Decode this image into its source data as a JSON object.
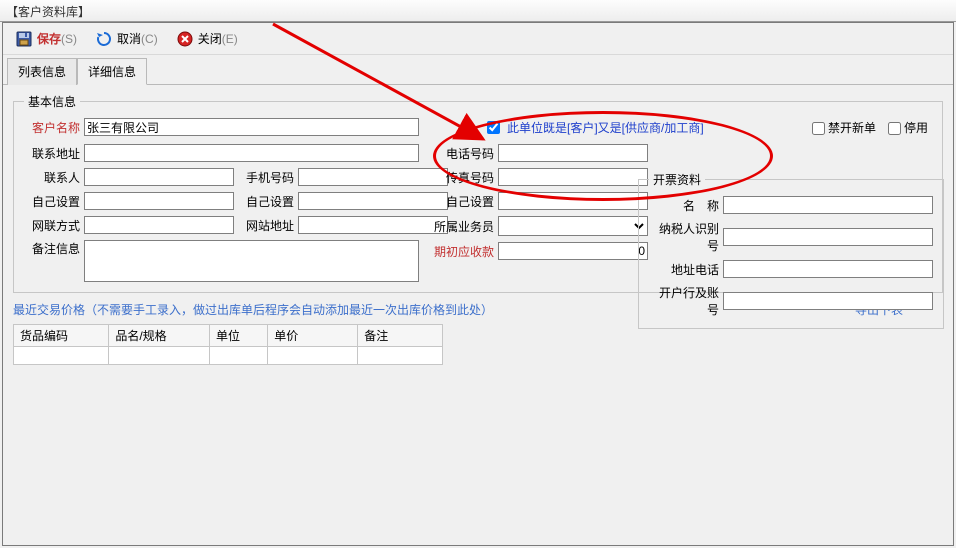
{
  "window": {
    "title": "【客户资料库】"
  },
  "toolbar": {
    "save": "保存",
    "save_hot": "(S)",
    "cancel": "取消",
    "cancel_hot": "(C)",
    "close": "关闭",
    "close_hot": "(E)"
  },
  "tabs": {
    "list": "列表信息",
    "detail": "详细信息"
  },
  "basic": {
    "legend": "基本信息",
    "customer_name_lbl": "客户名称",
    "customer_name": "张三有限公司",
    "both_role": "此单位既是[客户]又是[供应商/加工商]",
    "both_checked": true,
    "no_new": "禁开新单",
    "suspend": "停用",
    "addr_lbl": "联系地址",
    "addr": "",
    "contact_lbl": "联系人",
    "contact": "",
    "mobile_lbl": "手机号码",
    "mobile": "",
    "custom1_lbl": "自己设置",
    "custom1": "",
    "custom2_lbl": "自己设置",
    "custom2": "",
    "netmode_lbl": "网联方式",
    "netmode": "",
    "website_lbl": "网站地址",
    "website": "",
    "remark_lbl": "备注信息",
    "remark": "",
    "phone_lbl": "电话号码",
    "phone": "",
    "fax_lbl": "传真号码",
    "fax": "",
    "custom3_lbl": "自己设置",
    "custom3": "",
    "sales_lbl": "所属业务员",
    "sales": "",
    "init_recv_lbl": "期初应收款",
    "init_recv": "0"
  },
  "invoice": {
    "legend": "开票资料",
    "name_lbl": "名　称",
    "name": "",
    "taxid_lbl": "纳税人识别号",
    "taxid": "",
    "phone_lbl": "地址电话",
    "phone": "",
    "bank_lbl": "开户行及账号",
    "bank": ""
  },
  "note": "最近交易价格（不需要手工录入，做过出库单后程序会自动添加最近一次出库价格到此处）",
  "export": "导出下表",
  "table": {
    "h1": "货品编码",
    "h2": "品名/规格",
    "h3": "单位",
    "h4": "单价",
    "h5": "备注"
  }
}
